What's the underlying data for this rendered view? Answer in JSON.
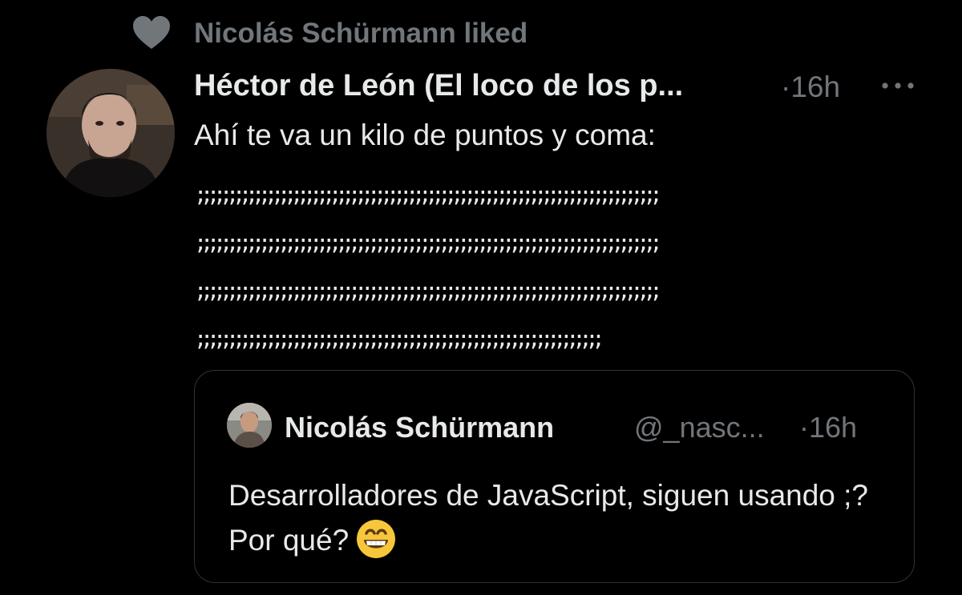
{
  "social_context": {
    "icon": "heart-icon",
    "text": "Nicolás Schürmann liked"
  },
  "tweet": {
    "author_name": "Héctor de León (El loco de los p...",
    "time": "·16h",
    "more_icon": "more-horizontal-icon",
    "text": "Ahí te va un kilo de puntos y coma:",
    "semicolon_lines": [
      ";;;;;;;;;;;;;;;;;;;;;;;;;;;;;;;;;;;;;;;;;;;;;;;;;;;;;;;;;;;;;;;;;;;;;;;;",
      ";;;;;;;;;;;;;;;;;;;;;;;;;;;;;;;;;;;;;;;;;;;;;;;;;;;;;;;;;;;;;;;;;;;;;;;;",
      ";;;;;;;;;;;;;;;;;;;;;;;;;;;;;;;;;;;;;;;;;;;;;;;;;;;;;;;;;;;;;;;;;;;;;;;;",
      ";;;;;;;;;;;;;;;;;;;;;;;;;;;;;;;;;;;;;;;;;;;;;;;;;;;;;;;;;;;;;;;"
    ]
  },
  "quoted_tweet": {
    "author_name": "Nicolás Schürmann",
    "handle": "@_nasc...",
    "time": "·16h",
    "text": "Desarrolladores de JavaScript, siguen usando ;? Por qué?",
    "emoji": "grinning-face-icon"
  },
  "colors": {
    "background": "#000000",
    "primary_text": "#e7e9ea",
    "secondary_text": "#71767b",
    "border": "#2f3336"
  }
}
